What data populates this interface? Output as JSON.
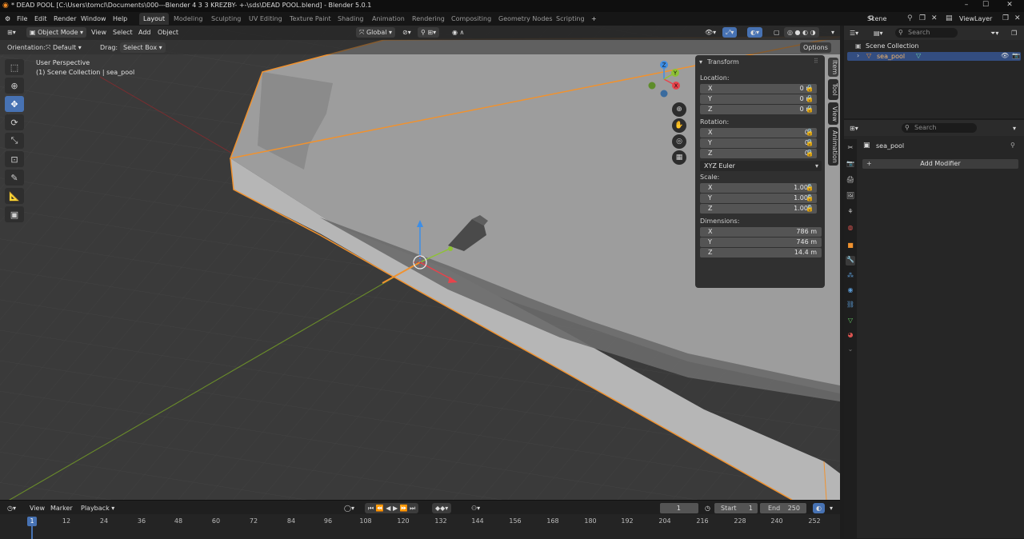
{
  "window": {
    "title": "* DEAD POOL [C:\\Users\\tomcl\\Documents\\000---Blender 4 3 3 KREZBY- +-\\sds\\DEAD POOL.blend] - Blender 5.0.1",
    "minimize": "–",
    "maximize": "☐",
    "close": "✕"
  },
  "menus": [
    "File",
    "Edit",
    "Render",
    "Window",
    "Help"
  ],
  "workspaces": [
    "Layout",
    "Modeling",
    "Sculpting",
    "UV Editing",
    "Texture Paint",
    "Shading",
    "Animation",
    "Rendering",
    "Compositing",
    "Geometry Nodes",
    "Scripting"
  ],
  "workspace_add": "+",
  "scene": {
    "name": "Scene",
    "view_layer": "ViewLayer"
  },
  "viewport_header": {
    "mode": "Object Mode",
    "menus": [
      "View",
      "Select",
      "Add",
      "Object"
    ],
    "transform_orientation": "Global",
    "options": "Options"
  },
  "tool_settings": {
    "orientation_label": "Orientation:",
    "orientation_value": "Default",
    "drag_label": "Drag:",
    "drag_value": "Select Box"
  },
  "overlay_text": {
    "view_name": "User Perspective",
    "collection_info": "(1) Scene Collection | sea_pool"
  },
  "gizmo_labels": {
    "x": "X",
    "y": "Y",
    "z": "Z"
  },
  "n_panel": {
    "section": "Transform",
    "location_label": "Location:",
    "location": [
      {
        "axis": "X",
        "value": "0 m"
      },
      {
        "axis": "Y",
        "value": "0 m"
      },
      {
        "axis": "Z",
        "value": "0 m"
      }
    ],
    "rotation_label": "Rotation:",
    "rotation": [
      {
        "axis": "X",
        "value": "0°"
      },
      {
        "axis": "Y",
        "value": "0°"
      },
      {
        "axis": "Z",
        "value": "0°"
      }
    ],
    "rotation_mode": "XYZ Euler",
    "scale_label": "Scale:",
    "scale": [
      {
        "axis": "X",
        "value": "1.000"
      },
      {
        "axis": "Y",
        "value": "1.000"
      },
      {
        "axis": "Z",
        "value": "1.000"
      }
    ],
    "dimensions_label": "Dimensions:",
    "dimensions": [
      {
        "axis": "X",
        "value": "786 m"
      },
      {
        "axis": "Y",
        "value": "746 m"
      },
      {
        "axis": "Z",
        "value": "14.4 m"
      }
    ]
  },
  "sidebar_tabs": [
    "Item",
    "Tool",
    "View",
    "Animation"
  ],
  "outliner": {
    "search_placeholder": "Search",
    "root": "Scene Collection",
    "object": "sea_pool"
  },
  "properties": {
    "search_placeholder": "Search",
    "object_name": "sea_pool",
    "add_modifier": "Add Modifier"
  },
  "timeline": {
    "menus": [
      "View",
      "Marker",
      "Playback"
    ],
    "current_frame": "1",
    "start_label": "Start",
    "start": "1",
    "end_label": "End",
    "end": "250",
    "ticks": [
      "1",
      "12",
      "24",
      "36",
      "48",
      "60",
      "72",
      "84",
      "96",
      "108",
      "120",
      "132",
      "144",
      "156",
      "168",
      "180",
      "192",
      "204",
      "216",
      "228",
      "240",
      "252"
    ]
  },
  "colors": {
    "accent": "#4772b3",
    "selection_outline": "#f0922f",
    "x_axis": "#e8434b",
    "y_axis": "#8ec234",
    "z_axis": "#3d8ee6"
  }
}
